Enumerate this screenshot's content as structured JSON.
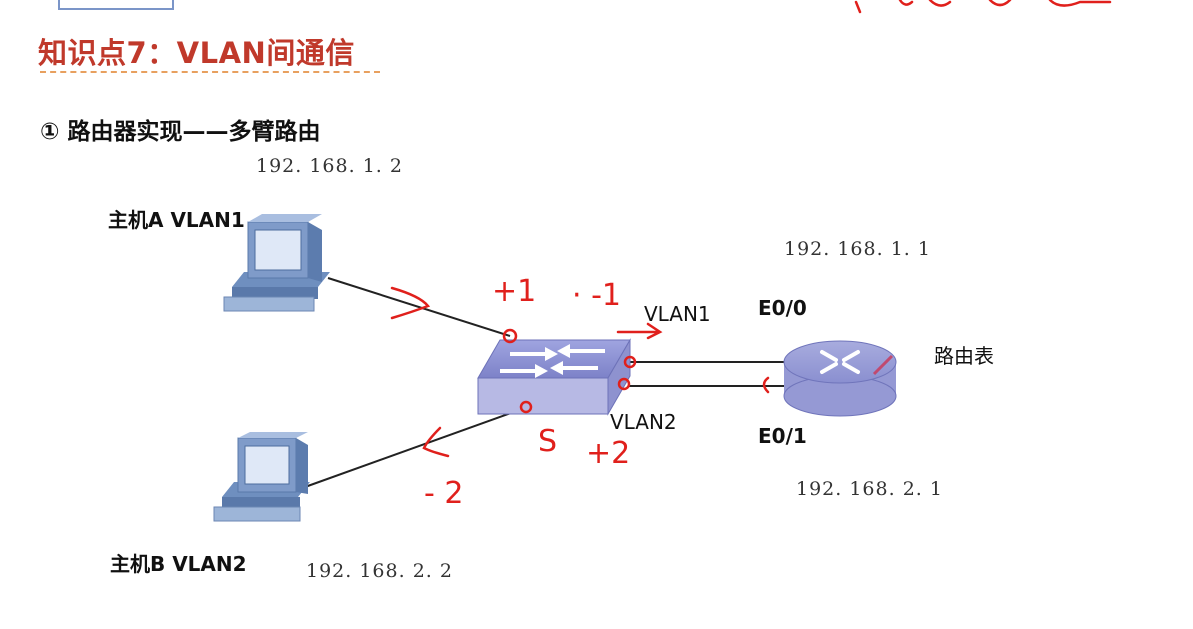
{
  "title": "知识点7：VLAN间通信",
  "subtitle": "① 路由器实现——多臂路由",
  "hosts": {
    "a": {
      "label": "主机A  VLAN1",
      "ip": "192. 168. 1. 2"
    },
    "b": {
      "label": "主机B  VLAN2",
      "ip": "192. 168. 2. 2"
    }
  },
  "router": {
    "ip_e0": "192. 168. 1. 1",
    "ip_e1": "192. 168. 2. 1",
    "port_e0": "E0/0",
    "port_e1": "E0/1",
    "table_label": "路由表"
  },
  "switch": {
    "vlan1_label": "VLAN1",
    "vlan2_label": "VLAN2"
  },
  "annotations": {
    "plus1": "+1",
    "minus1": "· -1",
    "s": "S",
    "plus2": "+2",
    "minus2": "- 2"
  },
  "colors": {
    "title": "#c0392b",
    "annotation": "#e0201c",
    "device": "#8a8fd0"
  }
}
